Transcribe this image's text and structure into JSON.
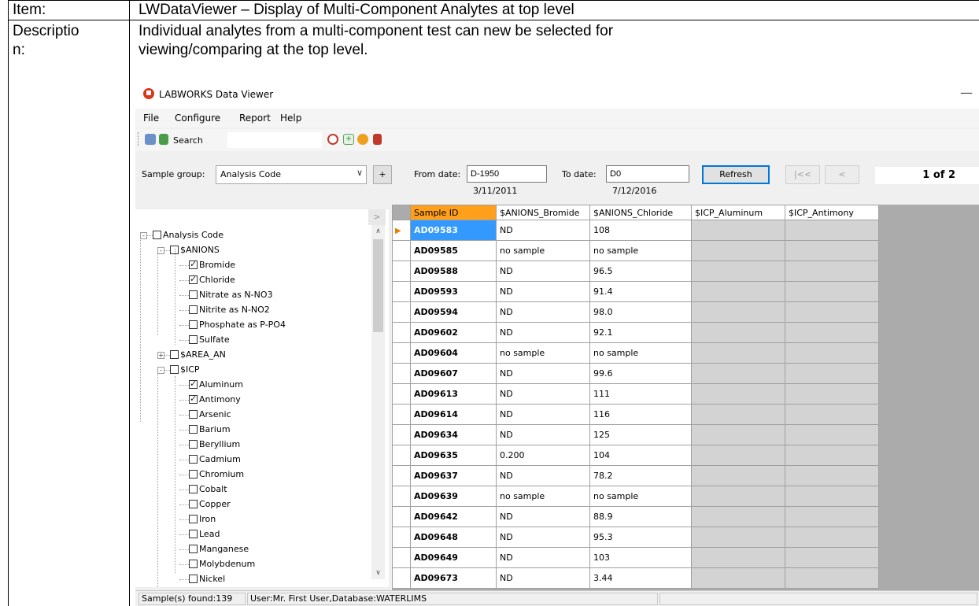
{
  "doc": {
    "item_label": "Item:",
    "item_value": "LWDataViewer – Display of Multi-Component Analytes at top level",
    "desc_label_1": "Descriptio",
    "desc_label_2": "n:",
    "desc_line_1": "Individual analytes from a multi-component test can new be selected for",
    "desc_line_2": "viewing/comparing at the top level."
  },
  "window": {
    "title": "LABWORKS Data Viewer",
    "minimize": "—"
  },
  "menu": {
    "file": "File",
    "configure": "Configure",
    "report": "Report",
    "help": "Help"
  },
  "toolbar": {
    "search_label": "Search",
    "search_value": "",
    "icons": [
      "print-icon",
      "export-icon",
      "magnifier-icon",
      "add-icon",
      "help-icon",
      "exit-icon"
    ]
  },
  "filter": {
    "sample_group_label": "Sample group:",
    "sample_group_value": "Analysis Code",
    "add_label": "+",
    "from_label": "From date:",
    "from_value": "D-1950",
    "from_resolved": "3/11/2011",
    "to_label": "To date:",
    "to_value": "D0",
    "to_resolved": "7/12/2016",
    "refresh_label": "Refresh",
    "first_label": "|<<",
    "prev_label": "<",
    "page": "1 of 2"
  },
  "tree": {
    "collapse_label": ">",
    "nodes": [
      {
        "label": "Analysis Code",
        "level": 0,
        "checked": false,
        "expander": "-"
      },
      {
        "label": "$ANIONS",
        "level": 1,
        "checked": false,
        "expander": "-"
      },
      {
        "label": "Bromide",
        "level": 2,
        "checked": true
      },
      {
        "label": "Chloride",
        "level": 2,
        "checked": true
      },
      {
        "label": "Nitrate as N-NO3",
        "level": 2,
        "checked": false
      },
      {
        "label": "Nitrite as N-NO2",
        "level": 2,
        "checked": false
      },
      {
        "label": "Phosphate as P-PO4",
        "level": 2,
        "checked": false
      },
      {
        "label": "Sulfate",
        "level": 2,
        "checked": false
      },
      {
        "label": "$AREA_AN",
        "level": 1,
        "checked": false,
        "expander": "+"
      },
      {
        "label": "$ICP",
        "level": 1,
        "checked": false,
        "expander": "-"
      },
      {
        "label": "Aluminum",
        "level": 2,
        "checked": true
      },
      {
        "label": "Antimony",
        "level": 2,
        "checked": true
      },
      {
        "label": "Arsenic",
        "level": 2,
        "checked": false
      },
      {
        "label": "Barium",
        "level": 2,
        "checked": false
      },
      {
        "label": "Beryllium",
        "level": 2,
        "checked": false
      },
      {
        "label": "Cadmium",
        "level": 2,
        "checked": false
      },
      {
        "label": "Chromium",
        "level": 2,
        "checked": false
      },
      {
        "label": "Cobalt",
        "level": 2,
        "checked": false
      },
      {
        "label": "Copper",
        "level": 2,
        "checked": false
      },
      {
        "label": "Iron",
        "level": 2,
        "checked": false
      },
      {
        "label": "Lead",
        "level": 2,
        "checked": false
      },
      {
        "label": "Manganese",
        "level": 2,
        "checked": false
      },
      {
        "label": "Molybdenum",
        "level": 2,
        "checked": false
      },
      {
        "label": "Nickel",
        "level": 2,
        "checked": false
      }
    ]
  },
  "grid": {
    "columns": [
      "Sample ID",
      "$ANIONS_Bromide",
      "$ANIONS_Chloride",
      "$ICP_Aluminum",
      "$ICP_Antimony"
    ],
    "rows": [
      [
        "AD09583",
        "ND",
        "108"
      ],
      [
        "AD09585",
        "no sample",
        "no sample"
      ],
      [
        "AD09588",
        "ND",
        "96.5"
      ],
      [
        "AD09593",
        "ND",
        "91.4"
      ],
      [
        "AD09594",
        "ND",
        "98.0"
      ],
      [
        "AD09602",
        "ND",
        "92.1"
      ],
      [
        "AD09604",
        "no sample",
        "no sample"
      ],
      [
        "AD09607",
        "ND",
        "99.6"
      ],
      [
        "AD09613",
        "ND",
        "111"
      ],
      [
        "AD09614",
        "ND",
        "116"
      ],
      [
        "AD09634",
        "ND",
        "125"
      ],
      [
        "AD09635",
        "0.200",
        "104"
      ],
      [
        "AD09637",
        "ND",
        "78.2"
      ],
      [
        "AD09639",
        "no sample",
        "no sample"
      ],
      [
        "AD09642",
        "ND",
        "88.9"
      ],
      [
        "AD09648",
        "ND",
        "95.3"
      ],
      [
        "AD09649",
        "ND",
        "103"
      ],
      [
        "AD09673",
        "ND",
        "3.44"
      ]
    ],
    "current_row": 0
  },
  "status": {
    "found": "Sample(s) found:139",
    "user": "User:Mr. First User,Database:WATERLIMS"
  }
}
